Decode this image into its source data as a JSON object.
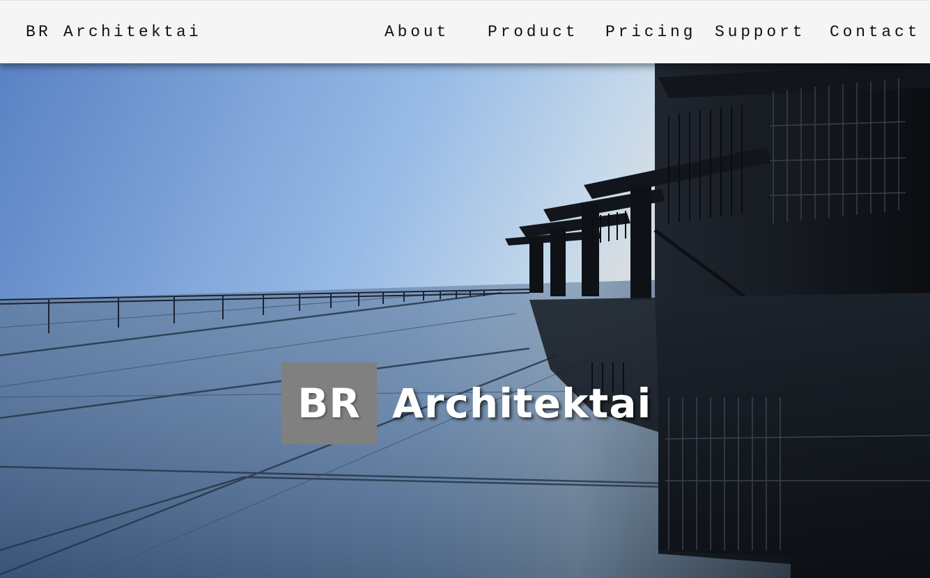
{
  "navbar": {
    "brand": "BR Architektai",
    "links": [
      {
        "label": "About"
      },
      {
        "label": "Product"
      },
      {
        "label": "Pricing"
      },
      {
        "label": "Support"
      },
      {
        "label": "Contact"
      }
    ]
  },
  "hero": {
    "logo_text": "BR",
    "title": "Architektai",
    "background_image": "building-facade-photo"
  },
  "colors": {
    "navbar_bg": "#f5f5f5",
    "logo_box": "#808080",
    "hero_text": "#ffffff",
    "sky_top": "#5e86c7",
    "sky_light": "#a8c6ea"
  }
}
